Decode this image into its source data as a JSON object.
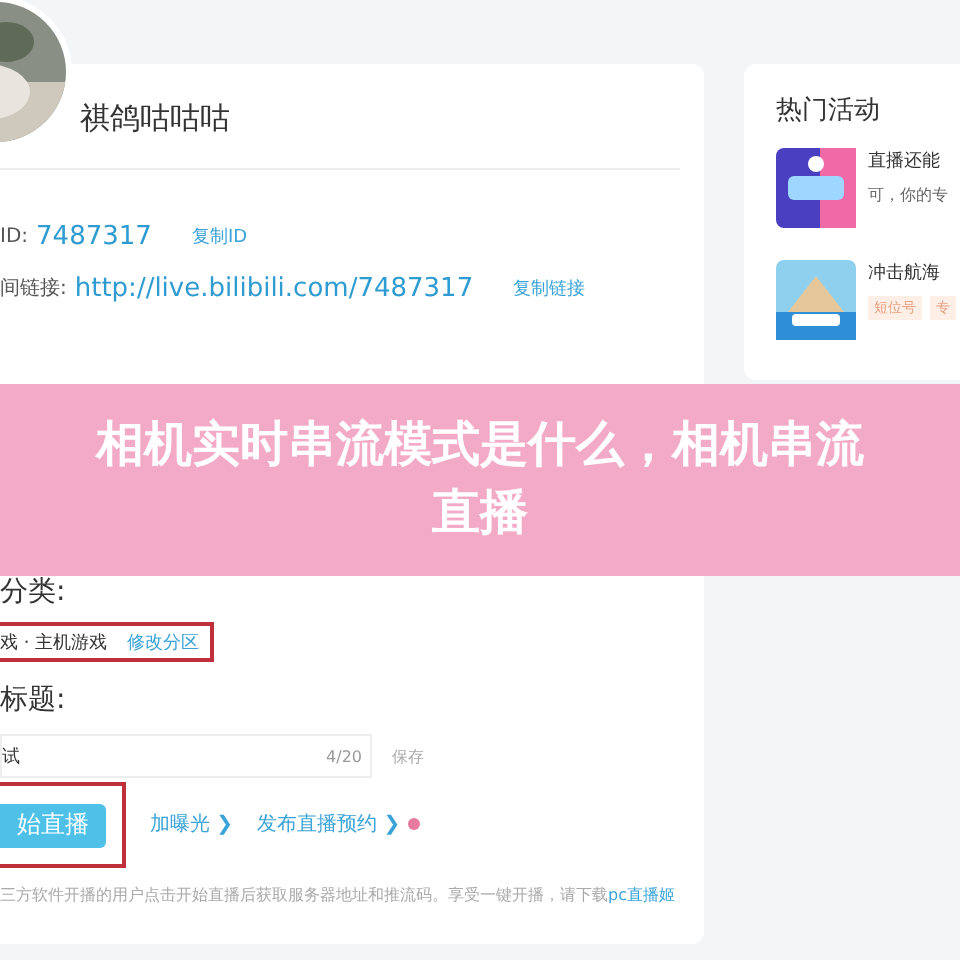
{
  "profile": {
    "name": "祺鸽咕咕咕"
  },
  "info_rows": [
    {
      "label": "ID:",
      "value": "7487317",
      "action": "复制ID"
    },
    {
      "label": "间链接:",
      "value": "http://live.bilibili.com/7487317",
      "action": "复制链接"
    }
  ],
  "banner": {
    "title": "相机实时串流模式是什么，相机串流直播"
  },
  "category": {
    "label": "分类:",
    "value": "戏 · 主机游戏",
    "action": "修改分区"
  },
  "title_field": {
    "label": "标题:",
    "value": "试",
    "count": "4/20",
    "save": "保存"
  },
  "actions": {
    "start": "始直播",
    "links": [
      "加曝光 ❯",
      "发布直播预约 ❯"
    ]
  },
  "footnote": {
    "text": "三方软件开播的用户点击开始直播后获取服务器地址和推流码。享受一键开播，请下载",
    "link": "pc直播姬"
  },
  "hot": {
    "title": "热门活动",
    "items": [
      {
        "kind": "text",
        "title": "直播还能",
        "subtitle": "可，你的专"
      },
      {
        "kind": "tags",
        "title": "冲击航海",
        "tags": [
          "短位号",
          "专"
        ]
      }
    ]
  }
}
